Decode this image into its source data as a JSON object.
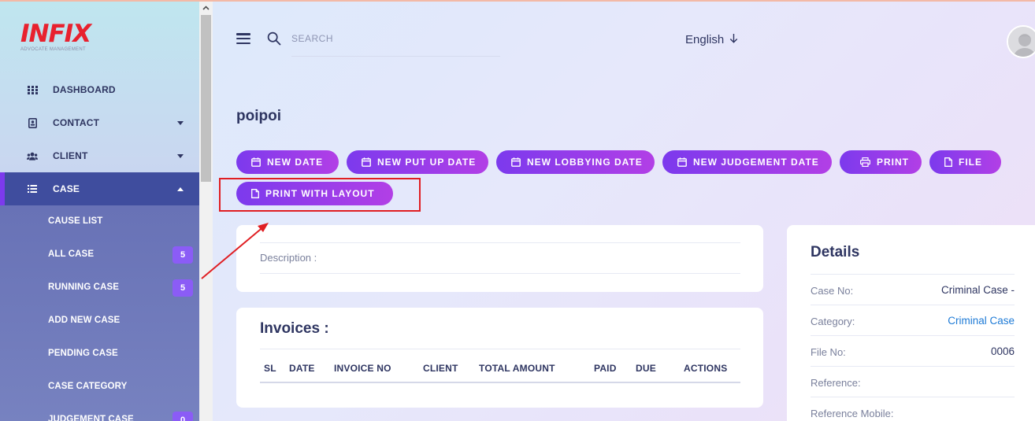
{
  "brand": {
    "logo": "INFIX",
    "subtitle": "ADVOCATE MANAGEMENT",
    "logo_color": "#e8212e"
  },
  "sidebar": {
    "items": [
      {
        "label": "DASHBOARD",
        "icon": "dashboard-grid-icon"
      },
      {
        "label": "CONTACT",
        "icon": "contact-book-icon"
      },
      {
        "label": "CLIENT",
        "icon": "users-icon"
      },
      {
        "label": "CASE",
        "icon": "list-icon"
      }
    ],
    "case_submenu": [
      {
        "label": "CAUSE LIST"
      },
      {
        "label": "ALL CASE",
        "badge": "5"
      },
      {
        "label": "RUNNING CASE",
        "badge": "5"
      },
      {
        "label": "ADD NEW CASE"
      },
      {
        "label": "PENDING CASE"
      },
      {
        "label": "CASE CATEGORY"
      },
      {
        "label": "JUDGEMENT CASE",
        "badge": "0"
      }
    ]
  },
  "header": {
    "search_placeholder": "SEARCH",
    "language": "English"
  },
  "page": {
    "title": "poipoi"
  },
  "actions": {
    "new_date": "NEW DATE",
    "new_put_up_date": "NEW PUT UP DATE",
    "new_lobbying_date": "NEW LOBBYING DATE",
    "new_judgement_date": "NEW JUDGEMENT DATE",
    "print": "PRINT",
    "file": "FILE",
    "print_with_layout": "PRINT WITH LAYOUT"
  },
  "description": {
    "label": "Description :"
  },
  "invoices": {
    "title": "Invoices :",
    "columns": [
      "SL",
      "DATE",
      "INVOICE NO",
      "CLIENT",
      "TOTAL AMOUNT",
      "PAID",
      "DUE",
      "ACTIONS"
    ]
  },
  "details": {
    "title": "Details",
    "rows": [
      {
        "key": "Case No:",
        "value": "Criminal Case -"
      },
      {
        "key": "Category:",
        "value": "Criminal Case"
      },
      {
        "key": "File No:",
        "value": "0006"
      },
      {
        "key": "Reference:",
        "value": ""
      },
      {
        "key": "Reference Mobile:",
        "value": ""
      }
    ]
  },
  "colors": {
    "accent": "#7c3aed",
    "button_gradient_end": "#b23fe6",
    "highlight": "#e01e22",
    "active_nav": "#3f4d9e"
  }
}
